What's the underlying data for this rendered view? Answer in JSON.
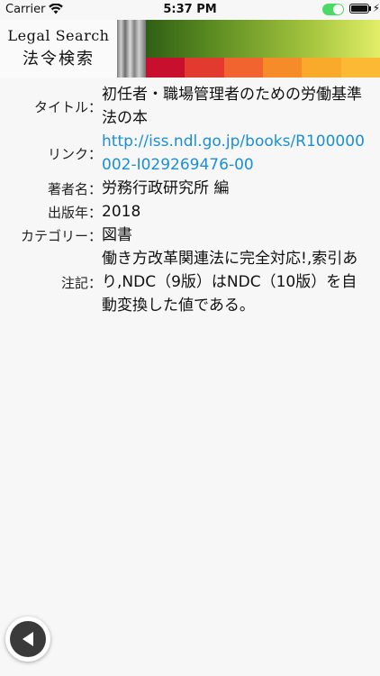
{
  "status_bar": {
    "carrier": "Carrier",
    "time": "5:37 PM"
  },
  "header": {
    "logo_en": "Legal Search",
    "logo_ja": "法令検索",
    "stripe_colors": [
      "#c8102e",
      "#e33a2f",
      "#f1632f",
      "#f68b2a",
      "#f9aa2a",
      "#fbb934"
    ]
  },
  "details": {
    "title": {
      "label": "タイトル",
      "value": "初任者・職場管理者のための労働基準法の本"
    },
    "link": {
      "label": "リンク",
      "value": "http://iss.ndl.go.jp/books/R100000002-I029269476-00"
    },
    "author": {
      "label": "著者名",
      "value": "労務行政研究所 編"
    },
    "year": {
      "label": "出版年",
      "value": "2018"
    },
    "category": {
      "label": "カテゴリー",
      "value": "図書"
    },
    "note": {
      "label": "注記",
      "value": "働き方改革関連法に完全対応!,索引あり,NDC（9版）はNDC（10版）を自動変換した値である。"
    }
  },
  "colon": "：",
  "icons": {
    "wifi": "wifi-icon",
    "back": "back-arrow-icon"
  }
}
